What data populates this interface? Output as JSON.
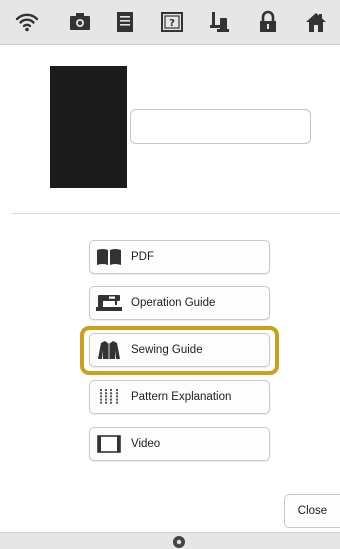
{
  "toolbar": {
    "icons": [
      "wifi-icon",
      "camera-icon",
      "document-icon",
      "help-icon",
      "bobbin-winding-icon",
      "lock-icon",
      "home-icon"
    ]
  },
  "preview": {
    "color": "#1b1b1b"
  },
  "name_field": {
    "value": ""
  },
  "menu": {
    "items": [
      {
        "label": "PDF",
        "icon": "book-icon"
      },
      {
        "label": "Operation Guide",
        "icon": "sewing-machine-icon"
      },
      {
        "label": "Sewing Guide",
        "icon": "jacket-icon"
      },
      {
        "label": "Pattern Explanation",
        "icon": "stitch-pattern-icon"
      },
      {
        "label": "Video",
        "icon": "film-icon"
      }
    ],
    "highlighted_index": 2,
    "highlight_color": "#c9a11a"
  },
  "close_label": "Close",
  "bottom_bar": {
    "icon": "sewing-mode-icon"
  }
}
